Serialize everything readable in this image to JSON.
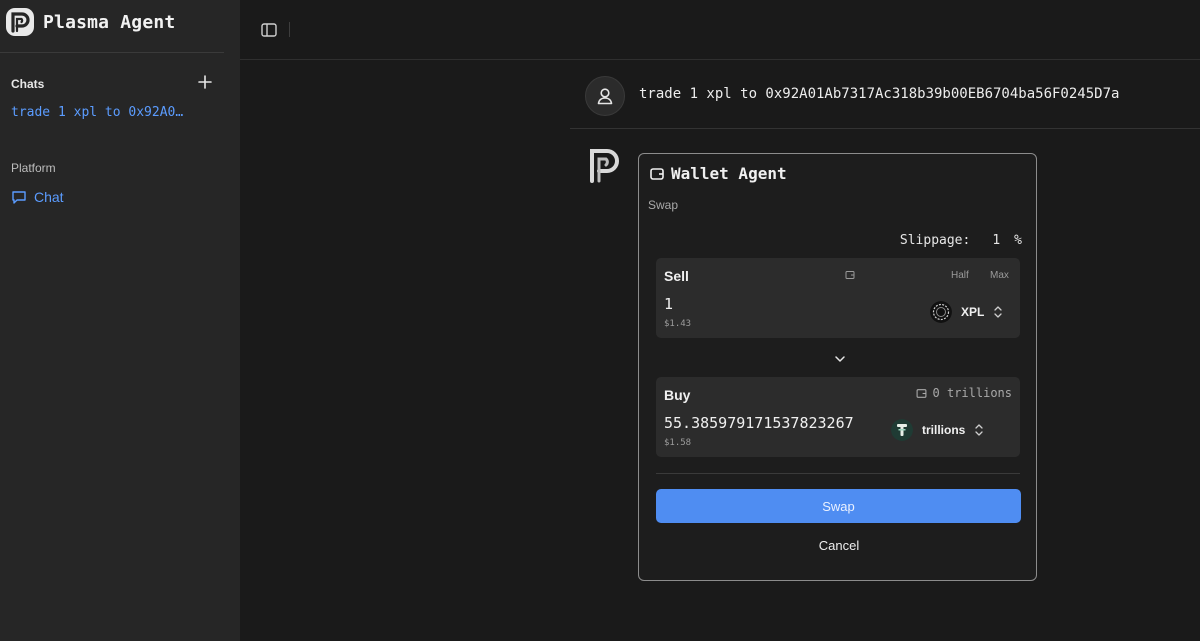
{
  "app": {
    "title": "Plasma Agent"
  },
  "sidebar": {
    "chats_title": "Chats",
    "chat_items": [
      {
        "label": "trade 1 xpl to 0x92A01Ab7317Ac318b39b00EB6704ba56F0245D7a"
      }
    ],
    "platform_title": "Platform",
    "nav_chat_label": "Chat"
  },
  "conversation": {
    "user_message": "trade 1 xpl to 0x92A01Ab7317Ac318b39b00EB6704ba56F0245D7a"
  },
  "wallet_card": {
    "title": "Wallet Agent",
    "subtitle": "Swap",
    "slippage_label": "Slippage:",
    "slippage_value": "1",
    "slippage_unit": "%",
    "sell": {
      "label": "Sell",
      "half_label": "Half",
      "max_label": "Max",
      "amount": "1",
      "usd": "$1.43",
      "token": "XPL"
    },
    "buy": {
      "label": "Buy",
      "balance": "0 trillions",
      "amount": "55.385979171537823267",
      "usd": "$1.58",
      "token": "trillions"
    },
    "swap_label": "Swap",
    "cancel_label": "Cancel"
  },
  "colors": {
    "accent": "#5b9cff",
    "button": "#4f8df2",
    "background": "#1a1a1a",
    "sidebar": "#262626",
    "panel": "#2c2c2c"
  },
  "icons": [
    "plasma-logo-icon",
    "plus-icon",
    "chat-bubble-icon",
    "sidebar-toggle-icon",
    "user-icon",
    "wallet-icon",
    "xpl-token-icon",
    "trillions-token-icon",
    "chevron-up-down-icon",
    "chevron-down-icon"
  ]
}
